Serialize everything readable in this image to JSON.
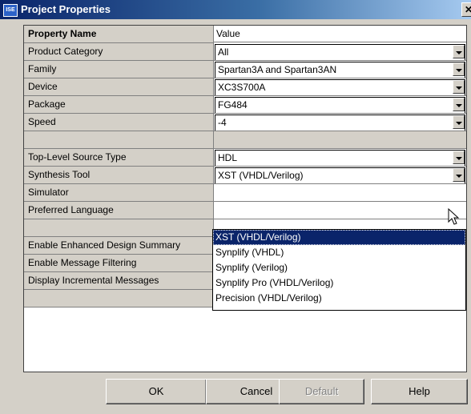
{
  "window": {
    "title": "Project Properties",
    "app_icon_text": "ISE",
    "close_icon": "close-icon"
  },
  "grid": {
    "header": {
      "name": "Property Name",
      "value": "Value"
    },
    "rows": [
      {
        "name": "Product Category",
        "value": "All",
        "kind": "combo"
      },
      {
        "name": "Family",
        "value": "Spartan3A and Spartan3AN",
        "kind": "combo"
      },
      {
        "name": "Device",
        "value": "XC3S700A",
        "kind": "combo"
      },
      {
        "name": "Package",
        "value": "FG484",
        "kind": "combo"
      },
      {
        "name": "Speed",
        "value": "-4",
        "kind": "combo"
      },
      {
        "name": "",
        "value": "",
        "kind": "blank"
      },
      {
        "name": "Top-Level Source Type",
        "value": "HDL",
        "kind": "combo"
      },
      {
        "name": "Synthesis Tool",
        "value": "XST (VHDL/Verilog)",
        "kind": "combo"
      },
      {
        "name": "Simulator",
        "value": "",
        "kind": "text"
      },
      {
        "name": "Preferred Language",
        "value": "",
        "kind": "text"
      },
      {
        "name": "",
        "value": "",
        "kind": "text"
      },
      {
        "name": "Enable Enhanced Design Summary",
        "value": "",
        "kind": "text"
      },
      {
        "name": "Enable Message Filtering",
        "value": "",
        "kind": "checkbox",
        "checked": false
      },
      {
        "name": "Display Incremental Messages",
        "value": "",
        "kind": "checkbox",
        "checked": false
      },
      {
        "name": "",
        "value": "",
        "kind": "blank"
      }
    ]
  },
  "dropdown": {
    "options": [
      "XST (VHDL/Verilog)",
      "Synplify (VHDL)",
      "Synplify (Verilog)",
      "Synplify Pro (VHDL/Verilog)",
      "Precision (VHDL/Verilog)"
    ],
    "selected_index": 0
  },
  "buttons": {
    "ok": "OK",
    "cancel": "Cancel",
    "default": "Default",
    "help": "Help"
  },
  "colors": {
    "face": "#d4d0c8",
    "title_start": "#0a246a",
    "title_end": "#a6caf0",
    "selection": "#0a246a"
  }
}
